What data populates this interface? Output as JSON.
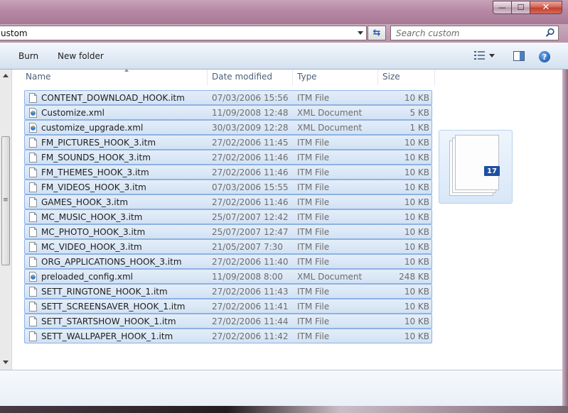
{
  "window": {
    "minimize_glyph": "—",
    "maximize_glyph": "☐",
    "close_glyph": "✕"
  },
  "address": {
    "path": "ustom",
    "refresh_glyph": "⇆"
  },
  "search": {
    "placeholder": "Search custom"
  },
  "toolbar": {
    "burn_label": "Burn",
    "new_folder_label": "New folder",
    "help_glyph": "?"
  },
  "columns": {
    "name": "Name",
    "date": "Date modified",
    "type": "Type",
    "size": "Size"
  },
  "files": [
    {
      "name": "CONTENT_DOWNLOAD_HOOK.itm",
      "date": "07/03/2006 15:56",
      "type": "ITM File",
      "size": "10 KB",
      "icon": "itm-file-icon"
    },
    {
      "name": "Customize.xml",
      "date": "11/09/2008 12:48",
      "type": "XML Document",
      "size": "5 KB",
      "icon": "xml-file-icon"
    },
    {
      "name": "customize_upgrade.xml",
      "date": "30/03/2009 12:28",
      "type": "XML Document",
      "size": "1 KB",
      "icon": "xml-file-icon"
    },
    {
      "name": "FM_PICTURES_HOOK_3.itm",
      "date": "27/02/2006 11:45",
      "type": "ITM File",
      "size": "10 KB",
      "icon": "itm-file-icon"
    },
    {
      "name": "FM_SOUNDS_HOOK_3.itm",
      "date": "27/02/2006 11:46",
      "type": "ITM File",
      "size": "10 KB",
      "icon": "itm-file-icon"
    },
    {
      "name": "FM_THEMES_HOOK_3.itm",
      "date": "27/02/2006 11:46",
      "type": "ITM File",
      "size": "10 KB",
      "icon": "itm-file-icon"
    },
    {
      "name": "FM_VIDEOS_HOOK_3.itm",
      "date": "07/03/2006 15:55",
      "type": "ITM File",
      "size": "10 KB",
      "icon": "itm-file-icon"
    },
    {
      "name": "GAMES_HOOK_3.itm",
      "date": "27/02/2006 11:46",
      "type": "ITM File",
      "size": "10 KB",
      "icon": "itm-file-icon"
    },
    {
      "name": "MC_MUSIC_HOOK_3.itm",
      "date": "25/07/2007 12:42",
      "type": "ITM File",
      "size": "10 KB",
      "icon": "itm-file-icon"
    },
    {
      "name": "MC_PHOTO_HOOK_3.itm",
      "date": "25/07/2007 12:47",
      "type": "ITM File",
      "size": "10 KB",
      "icon": "itm-file-icon"
    },
    {
      "name": "MC_VIDEO_HOOK_3.itm",
      "date": "21/05/2007 7:30",
      "type": "ITM File",
      "size": "10 KB",
      "icon": "itm-file-icon"
    },
    {
      "name": "ORG_APPLICATIONS_HOOK_3.itm",
      "date": "27/02/2006 11:40",
      "type": "ITM File",
      "size": "10 KB",
      "icon": "itm-file-icon"
    },
    {
      "name": "preloaded_config.xml",
      "date": "11/09/2008 8:00",
      "type": "XML Document",
      "size": "248 KB",
      "icon": "xml-file-icon"
    },
    {
      "name": "SETT_RINGTONE_HOOK_1.itm",
      "date": "27/02/2006 11:43",
      "type": "ITM File",
      "size": "10 KB",
      "icon": "itm-file-icon"
    },
    {
      "name": "SETT_SCREENSAVER_HOOK_1.itm",
      "date": "27/02/2006 11:41",
      "type": "ITM File",
      "size": "10 KB",
      "icon": "itm-file-icon"
    },
    {
      "name": "SETT_STARTSHOW_HOOK_1.itm",
      "date": "27/02/2006 11:44",
      "type": "ITM File",
      "size": "10 KB",
      "icon": "itm-file-icon"
    },
    {
      "name": "SETT_WALLPAPER_HOOK_1.itm",
      "date": "27/02/2006 11:42",
      "type": "ITM File",
      "size": "10 KB",
      "icon": "itm-file-icon"
    }
  ],
  "preview": {
    "selected_count": "17"
  },
  "colors": {
    "selection_fill": "#d2e2f4",
    "selection_border": "#8db2e3",
    "count_badge": "#1f4fa3"
  }
}
